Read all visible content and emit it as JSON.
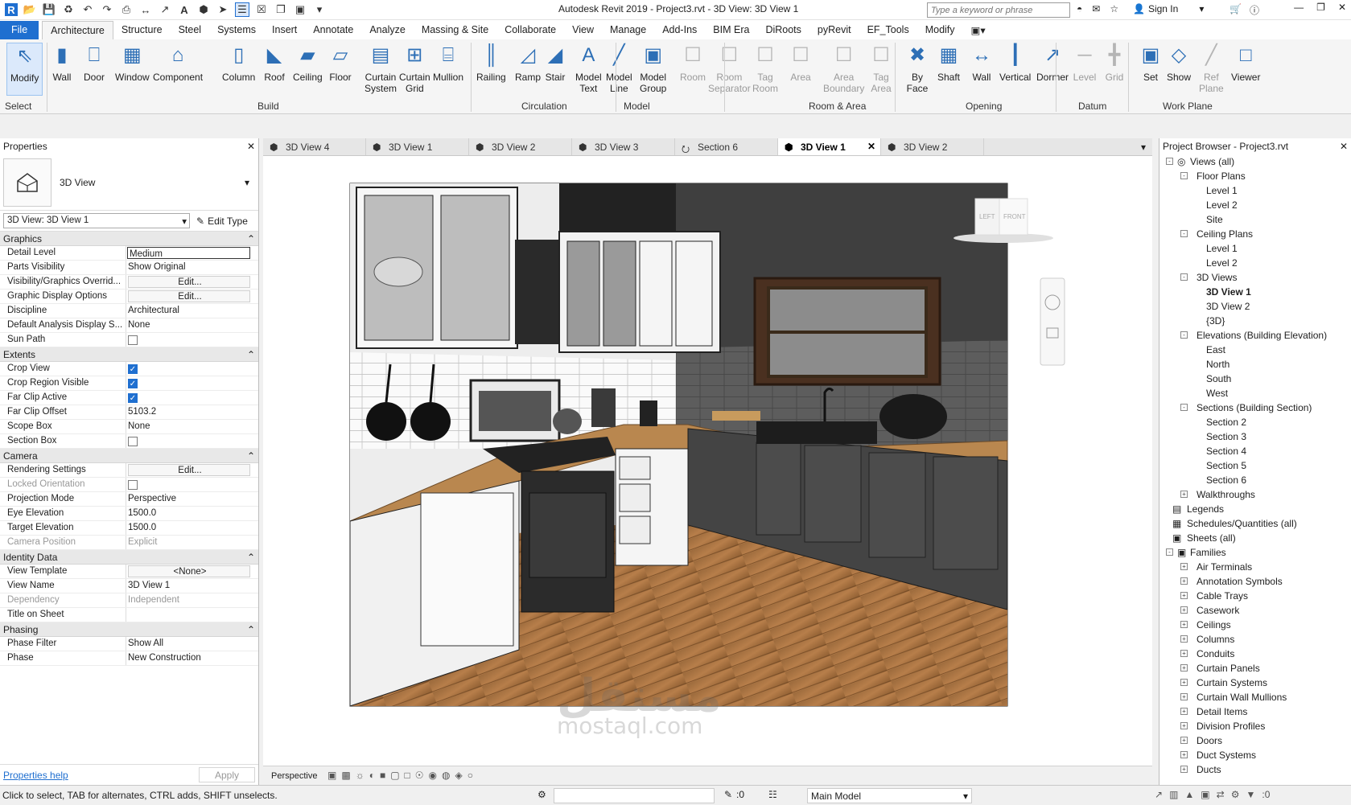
{
  "app": {
    "title": "Autodesk Revit 2019 - Project3.rvt - 3D View: 3D View 1",
    "logo": "R"
  },
  "titlebar": {
    "search_placeholder": "Type a keyword or phrase",
    "sign_in": "Sign In"
  },
  "menu_tabs": [
    "File",
    "Architecture",
    "Structure",
    "Steel",
    "Systems",
    "Insert",
    "Annotate",
    "Analyze",
    "Massing & Site",
    "Collaborate",
    "View",
    "Manage",
    "Add-Ins",
    "BIM Era",
    "DiRoots",
    "pyRevit",
    "EF_Tools",
    "Modify"
  ],
  "ribbon": {
    "buttons": [
      {
        "label": "Modify",
        "icon": "cursor-icon"
      },
      {
        "label": "Wall",
        "icon": "wall-icon"
      },
      {
        "label": "Door",
        "icon": "door-icon"
      },
      {
        "label": "Window",
        "icon": "window-icon"
      },
      {
        "label": "Component",
        "icon": "component-icon"
      },
      {
        "label": "Column",
        "icon": "column-icon"
      },
      {
        "label": "Roof",
        "icon": "roof-icon"
      },
      {
        "label": "Ceiling",
        "icon": "ceiling-icon"
      },
      {
        "label": "Floor",
        "icon": "floor-icon"
      },
      {
        "label": "Curtain\nSystem",
        "icon": "curtain-system-icon"
      },
      {
        "label": "Curtain\nGrid",
        "icon": "curtain-grid-icon"
      },
      {
        "label": "Mullion",
        "icon": "mullion-icon"
      },
      {
        "label": "Railing",
        "icon": "railing-icon"
      },
      {
        "label": "Ramp",
        "icon": "ramp-icon"
      },
      {
        "label": "Stair",
        "icon": "stair-icon"
      },
      {
        "label": "Model\nText",
        "icon": "model-text-icon"
      },
      {
        "label": "Model\nLine",
        "icon": "model-line-icon"
      },
      {
        "label": "Model\nGroup",
        "icon": "model-group-icon"
      },
      {
        "label": "Room",
        "icon": "room-icon"
      },
      {
        "label": "Room\nSeparator",
        "icon": "room-separator-icon"
      },
      {
        "label": "Tag\nRoom",
        "icon": "tag-room-icon"
      },
      {
        "label": "Area",
        "icon": "area-icon"
      },
      {
        "label": "Area\nBoundary",
        "icon": "area-boundary-icon"
      },
      {
        "label": "Tag\nArea",
        "icon": "tag-area-icon"
      },
      {
        "label": "By\nFace",
        "icon": "by-face-icon"
      },
      {
        "label": "Shaft",
        "icon": "shaft-icon"
      },
      {
        "label": "Wall",
        "icon": "wall-opening-icon"
      },
      {
        "label": "Vertical",
        "icon": "vertical-icon"
      },
      {
        "label": "Dormer",
        "icon": "dormer-icon"
      },
      {
        "label": "Level",
        "icon": "level-icon"
      },
      {
        "label": "Grid",
        "icon": "grid-icon"
      },
      {
        "label": "Set",
        "icon": "set-icon"
      },
      {
        "label": "Show",
        "icon": "show-icon"
      },
      {
        "label": "Ref\nPlane",
        "icon": "ref-plane-icon"
      },
      {
        "label": "Viewer",
        "icon": "viewer-icon"
      }
    ],
    "panels": [
      "Select",
      "Build",
      "Circulation",
      "Model",
      "Room & Area",
      "Opening",
      "Datum",
      "Work Plane"
    ]
  },
  "properties": {
    "title": "Properties",
    "type_name": "3D View",
    "selector": "3D View: 3D View 1",
    "edit_type": "Edit Type",
    "sections": [
      {
        "name": "Graphics",
        "rows": [
          {
            "k": "Detail Level",
            "v": "Medium"
          },
          {
            "k": "Parts Visibility",
            "v": "Show Original"
          },
          {
            "k": "Visibility/Graphics Overrid...",
            "v": "Edit..."
          },
          {
            "k": "Graphic Display Options",
            "v": "Edit..."
          },
          {
            "k": "Discipline",
            "v": "Architectural"
          },
          {
            "k": "Default Analysis Display S...",
            "v": "None"
          },
          {
            "k": "Sun Path",
            "v": ""
          }
        ]
      },
      {
        "name": "Extents",
        "rows": [
          {
            "k": "Crop View",
            "v": ""
          },
          {
            "k": "Crop Region Visible",
            "v": ""
          },
          {
            "k": "Far Clip Active",
            "v": ""
          },
          {
            "k": "Far Clip Offset",
            "v": "5103.2"
          },
          {
            "k": "Scope Box",
            "v": "None"
          },
          {
            "k": "Section Box",
            "v": ""
          }
        ]
      },
      {
        "name": "Camera",
        "rows": [
          {
            "k": "Rendering Settings",
            "v": "Edit..."
          },
          {
            "k": "Locked Orientation",
            "v": ""
          },
          {
            "k": "Projection Mode",
            "v": "Perspective"
          },
          {
            "k": "Eye Elevation",
            "v": "1500.0"
          },
          {
            "k": "Target Elevation",
            "v": "1500.0"
          },
          {
            "k": "Camera Position",
            "v": "Explicit"
          }
        ]
      },
      {
        "name": "Identity Data",
        "rows": [
          {
            "k": "View Template",
            "v": "<None>"
          },
          {
            "k": "View Name",
            "v": "3D View 1"
          },
          {
            "k": "Dependency",
            "v": "Independent"
          },
          {
            "k": "Title on Sheet",
            "v": ""
          }
        ]
      },
      {
        "name": "Phasing",
        "rows": [
          {
            "k": "Phase Filter",
            "v": "Show All"
          },
          {
            "k": "Phase",
            "v": "New Construction"
          }
        ]
      }
    ],
    "help": "Properties help",
    "apply": "Apply"
  },
  "view_tabs": [
    "3D View 4",
    "3D View 1",
    "3D View 2",
    "3D View 3",
    "Section 6",
    "3D View 1",
    "3D View 2"
  ],
  "viewcube": {
    "left": "LEFT",
    "front": "FRONT"
  },
  "view_control": {
    "mode": "Perspective"
  },
  "watermark": {
    "arabic": "مستقل",
    "latin": "mostaql.com"
  },
  "browser": {
    "title": "Project Browser - Project3.rvt",
    "nodes": [
      {
        "t": "Views (all)",
        "d": 0,
        "ex": "-"
      },
      {
        "t": "Floor Plans",
        "d": 1,
        "ex": "-"
      },
      {
        "t": "Level 1",
        "d": 2
      },
      {
        "t": "Level 2",
        "d": 2
      },
      {
        "t": "Site",
        "d": 2
      },
      {
        "t": "Ceiling Plans",
        "d": 1,
        "ex": "-"
      },
      {
        "t": "Level 1",
        "d": 2
      },
      {
        "t": "Level 2",
        "d": 2
      },
      {
        "t": "3D Views",
        "d": 1,
        "ex": "-"
      },
      {
        "t": "3D View 1",
        "d": 2,
        "bold": true
      },
      {
        "t": "3D View 2",
        "d": 2
      },
      {
        "t": "{3D}",
        "d": 2
      },
      {
        "t": "Elevations (Building Elevation)",
        "d": 1,
        "ex": "-"
      },
      {
        "t": "East",
        "d": 2
      },
      {
        "t": "North",
        "d": 2
      },
      {
        "t": "South",
        "d": 2
      },
      {
        "t": "West",
        "d": 2
      },
      {
        "t": "Sections (Building Section)",
        "d": 1,
        "ex": "-"
      },
      {
        "t": "Section 2",
        "d": 2
      },
      {
        "t": "Section 3",
        "d": 2
      },
      {
        "t": "Section 4",
        "d": 2
      },
      {
        "t": "Section 5",
        "d": 2
      },
      {
        "t": "Section 6",
        "d": 2
      },
      {
        "t": "Walkthroughs",
        "d": 1,
        "ex": "+"
      },
      {
        "t": "Legends",
        "d": 0
      },
      {
        "t": "Schedules/Quantities (all)",
        "d": 0
      },
      {
        "t": "Sheets (all)",
        "d": 0
      },
      {
        "t": "Families",
        "d": 0,
        "ex": "-"
      },
      {
        "t": "Air Terminals",
        "d": 1,
        "ex": "+"
      },
      {
        "t": "Annotation Symbols",
        "d": 1,
        "ex": "+"
      },
      {
        "t": "Cable Trays",
        "d": 1,
        "ex": "+"
      },
      {
        "t": "Casework",
        "d": 1,
        "ex": "+"
      },
      {
        "t": "Ceilings",
        "d": 1,
        "ex": "+"
      },
      {
        "t": "Columns",
        "d": 1,
        "ex": "+"
      },
      {
        "t": "Conduits",
        "d": 1,
        "ex": "+"
      },
      {
        "t": "Curtain Panels",
        "d": 1,
        "ex": "+"
      },
      {
        "t": "Curtain Systems",
        "d": 1,
        "ex": "+"
      },
      {
        "t": "Curtain Wall Mullions",
        "d": 1,
        "ex": "+"
      },
      {
        "t": "Detail Items",
        "d": 1,
        "ex": "+"
      },
      {
        "t": "Division Profiles",
        "d": 1,
        "ex": "+"
      },
      {
        "t": "Doors",
        "d": 1,
        "ex": "+"
      },
      {
        "t": "Duct Systems",
        "d": 1,
        "ex": "+"
      },
      {
        "t": "Ducts",
        "d": 1,
        "ex": "+"
      }
    ]
  },
  "status": {
    "hint": "Click to select, TAB for alternates, CTRL adds, SHIFT unselects.",
    "filter": ":0",
    "model": "Main Model",
    "sel": ":0"
  }
}
